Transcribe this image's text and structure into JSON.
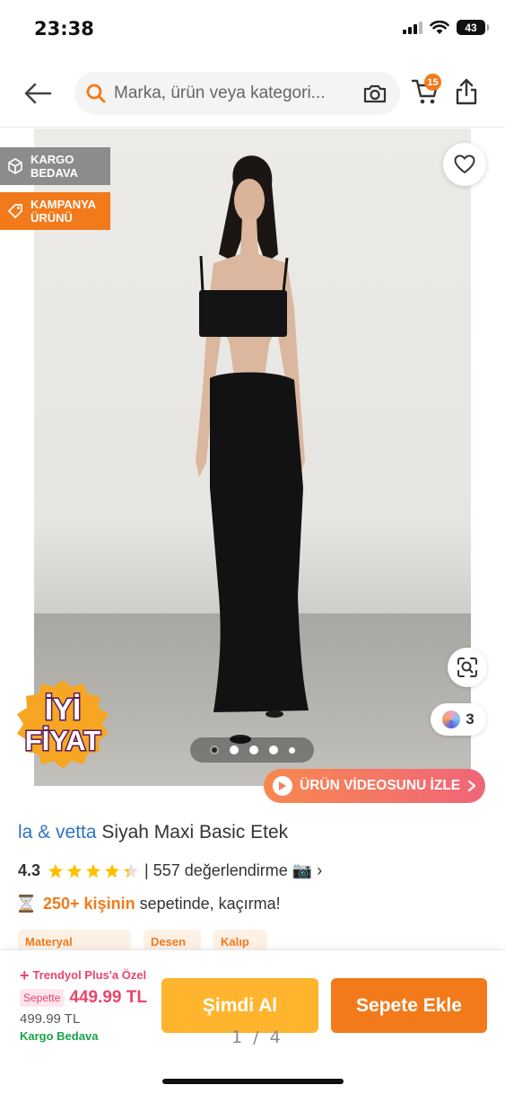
{
  "status_bar": {
    "time": "23:38",
    "battery": "43",
    "icons": [
      "cellular-signal-icon",
      "wifi-icon",
      "battery-icon"
    ]
  },
  "nav": {
    "search_placeholder": "Marka, ürün veya kategori...",
    "cart_count": "15",
    "icons": [
      "back-arrow-icon",
      "search-icon",
      "camera-search-icon",
      "cart-icon",
      "share-icon"
    ]
  },
  "gallery": {
    "badges": [
      {
        "label_line1": "KARGO",
        "label_line2": "BEDAVA",
        "color": "#8c8c8c"
      },
      {
        "label_line1": "KAMPANYA",
        "label_line2": "ÜRÜNÜ",
        "color": "#f27a1a"
      }
    ],
    "promo_sticker": {
      "line1": "İYİ",
      "line2": "FİYAT"
    },
    "color_count": "3",
    "video_button": "ÜRÜN VİDEOSUNU İZLE",
    "total_images": 4,
    "current_image": 1
  },
  "product": {
    "brand": "la & vetta",
    "name": "Siyah Maxi Basic Etek",
    "rating": "4.3",
    "review_text": "| 557 değerlendirme 📷 ›",
    "cart_highlight": "250+ kişinin",
    "cart_rest": "sepetinde, kaçırma!",
    "attribute_chips": [
      "Materyal",
      "Desen",
      "Kalıp"
    ]
  },
  "bottom_bar": {
    "plus_label": "Trendyol Plus'a Özel",
    "basket_label": "Sepette",
    "basket_price": "449.99 TL",
    "old_price": "499.99 TL",
    "shipping": "Kargo Bedava",
    "buy_now": "Şimdi Al",
    "add_to_cart": "Sepete Ekle",
    "page_indicator": "1 / 4"
  },
  "colors": {
    "brand_orange": "#f27a1a",
    "buy_now_yellow": "#ffb42e",
    "brand_blue": "#2d73c4",
    "plus_pink": "#e9456c",
    "free_ship_green": "#1aa34a"
  }
}
